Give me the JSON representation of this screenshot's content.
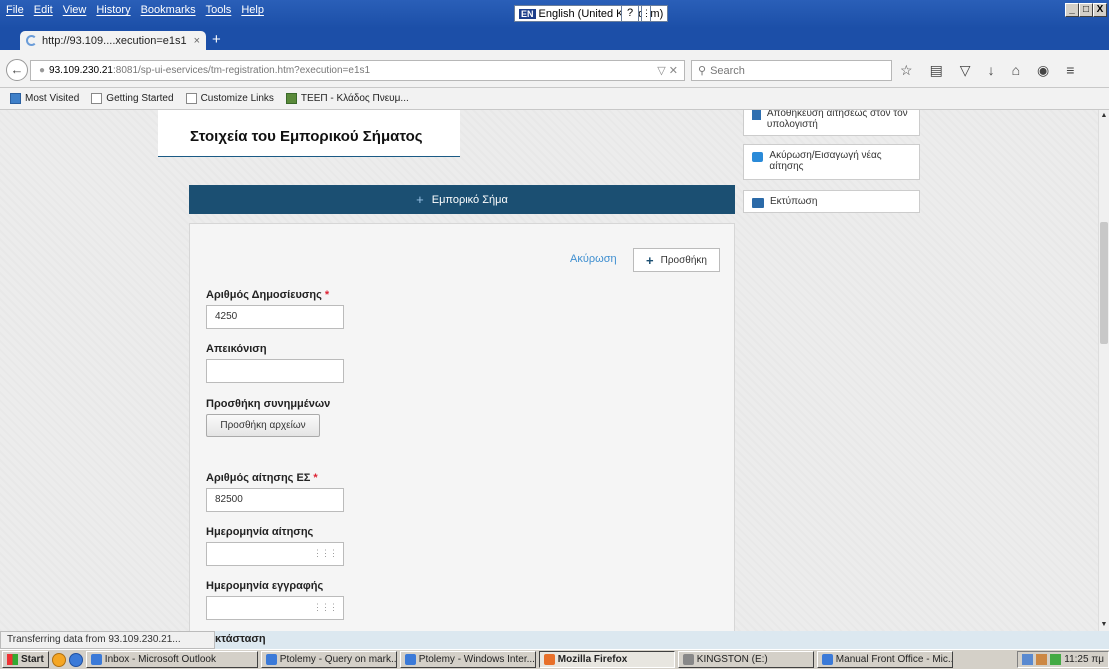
{
  "browser": {
    "menu": [
      "File",
      "Edit",
      "View",
      "History",
      "Bookmarks",
      "Tools",
      "Help"
    ],
    "language_badge": "EN",
    "language_label": "English (United Kingdom)",
    "language_help": "?",
    "window_controls": [
      "_",
      "□",
      "X"
    ],
    "tab_title": "http://93.109....xecution=e1s1",
    "tab_close": "×",
    "new_tab": "+",
    "url_host": "93.109.230.21",
    "url_path": ":8081/sp-ui-eservices/tm-registration.htm?execution=e1s1",
    "url_actions": "▽ ✕",
    "search_placeholder": "Search",
    "bookmarks": [
      "Most Visited",
      "Getting Started",
      "Customize Links",
      "ΤΕΕΠ - Κλάδος Πνευμ..."
    ],
    "status_text": "Transferring data from 93.109.230.21..."
  },
  "page": {
    "section_title": "Στοιχεία του Εμπορικού Σήματος",
    "side_buttons": [
      {
        "label": "Αποθήκευση αιτήσεως στον τον υπολογιστή",
        "icon": "save-icon"
      },
      {
        "label": "Ακύρωση/Εισαγωγή νέας αίτησης",
        "icon": "cancel-new-icon"
      },
      {
        "label": "Εκτύπωση",
        "icon": "print-icon"
      }
    ],
    "panel_header": "Εμπορικό Σήμα",
    "cancel_link": "Ακύρωση",
    "add_button": "Προσθήκη",
    "fields": {
      "publication_number_label": "Αριθμός Δημοσίευσης",
      "publication_number_value": "4250",
      "depiction_label": "Απεικόνιση",
      "depiction_value": "",
      "attachments_label": "Προσθήκη συνημμένων",
      "attachments_button": "Προσθήκη αρχείων",
      "application_number_label": "Αριθμός αίτησης ΕΣ",
      "application_number_value": "82500",
      "application_date_label": "Ημερομηνία αίτησης",
      "registration_date_label": "Ημερομηνία εγγραφής",
      "status_label_partial": "κτάσταση"
    },
    "required_mark": "*"
  },
  "taskbar": {
    "start": "Start",
    "tasks": [
      {
        "label": "Inbox - Microsoft Outlook",
        "active": false
      },
      {
        "label": "Ptolemy - Query on mark...",
        "active": false
      },
      {
        "label": "Ptolemy - Windows Inter...",
        "active": false
      },
      {
        "label": "Mozilla Firefox",
        "active": true
      },
      {
        "label": "KINGSTON (E:)",
        "active": false
      },
      {
        "label": "Manual Front Office - Mic...",
        "active": false
      }
    ],
    "clock": "11:25 πμ"
  }
}
